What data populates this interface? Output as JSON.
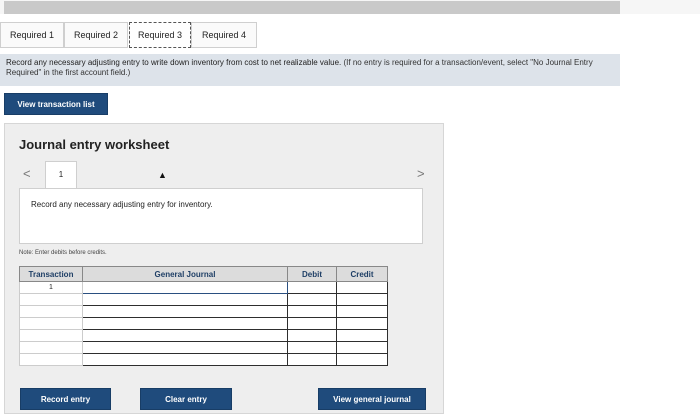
{
  "tabs": [
    {
      "label": "Required 1"
    },
    {
      "label": "Required 2"
    },
    {
      "label": "Required 3"
    },
    {
      "label": "Required 4"
    }
  ],
  "active_tab": "Required 3",
  "prompt": {
    "text": "Record any necessary adjusting entry to write down inventory from cost to net realizable value.",
    "note": "(If no entry is required for a transaction/event, select \"No Journal Entry Required\" in the first account field.)"
  },
  "view_transactions_label": "View transaction list",
  "worksheet": {
    "title": "Journal entry worksheet",
    "prev_arrow": "<",
    "next_arrow": ">",
    "entry_number": "1",
    "instruction": "Record any necessary adjusting entry for inventory.",
    "note": "Note: Enter debits before credits."
  },
  "journal": {
    "headers": [
      "Transaction",
      "General Journal",
      "Debit",
      "Credit"
    ],
    "rows": [
      {
        "transaction": "1",
        "account": "",
        "debit": "",
        "credit": ""
      },
      {
        "transaction": "",
        "account": "",
        "debit": "",
        "credit": ""
      },
      {
        "transaction": "",
        "account": "",
        "debit": "",
        "credit": ""
      },
      {
        "transaction": "",
        "account": "",
        "debit": "",
        "credit": ""
      },
      {
        "transaction": "",
        "account": "",
        "debit": "",
        "credit": ""
      },
      {
        "transaction": "",
        "account": "",
        "debit": "",
        "credit": ""
      },
      {
        "transaction": "",
        "account": "",
        "debit": "",
        "credit": ""
      }
    ]
  },
  "buttons": {
    "record": "Record entry",
    "clear": "Clear entry",
    "view_general_journal": "View general journal"
  },
  "colors": {
    "button_blue": "#1f4b7c",
    "prompt_bg": "#dde3ea",
    "worksheet_bg": "#eeeeee"
  }
}
